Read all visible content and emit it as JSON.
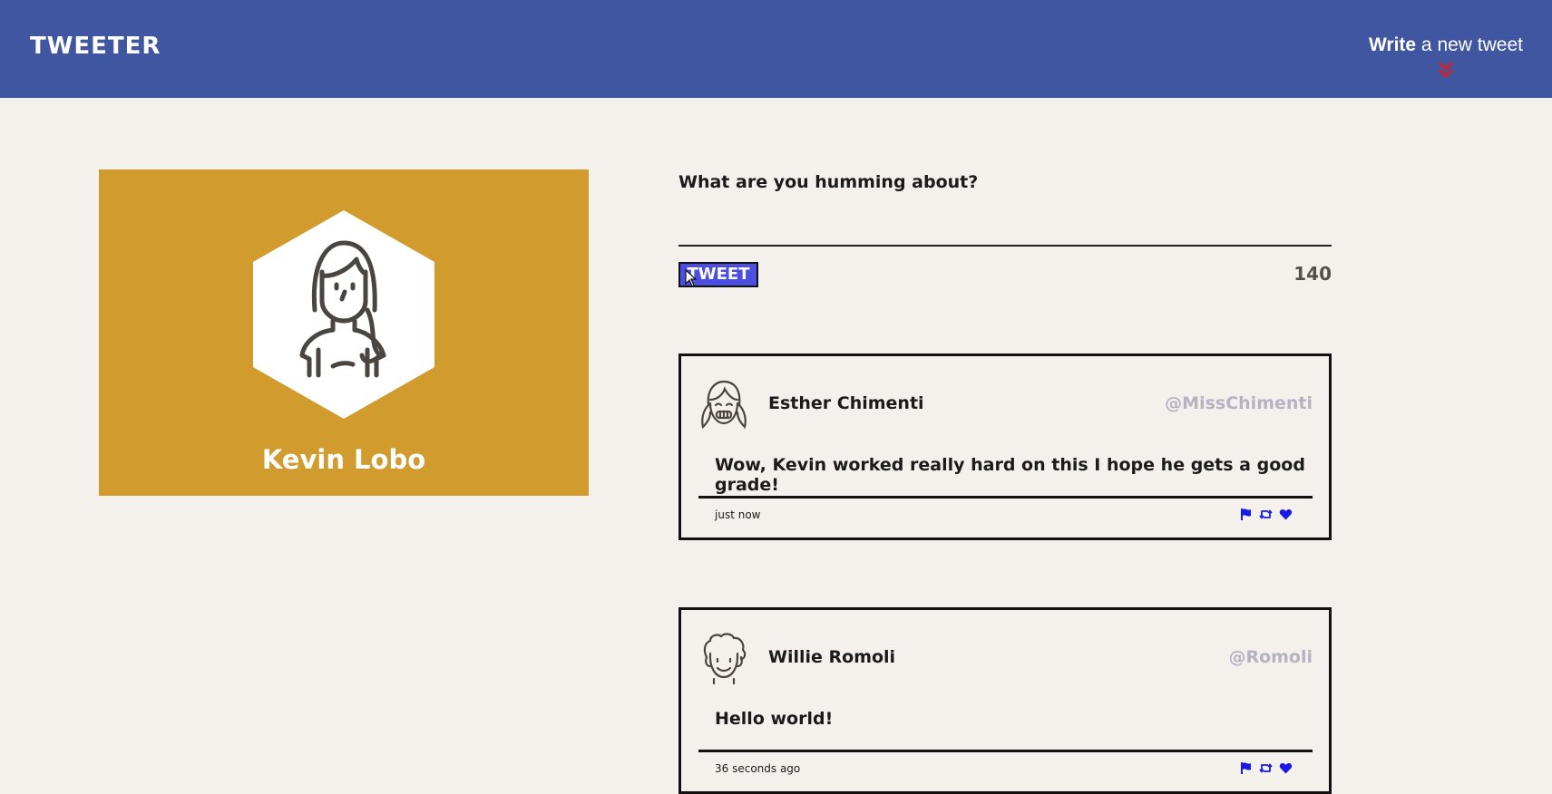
{
  "nav": {
    "brand": "TWEETER",
    "compose_bold": "Write",
    "compose_rest": " a new tweet",
    "chevron_icon": "double-chevron-down-icon",
    "chevron_color": "#d0202a",
    "background": "#4056a1"
  },
  "profile": {
    "name": "Kevin Lobo",
    "avatar_icon": "woman-avatar-icon",
    "background": "#d19b2e"
  },
  "compose": {
    "label": "What are you humming about?",
    "input_value": "",
    "button_label": "TWEET",
    "counter": "140",
    "button_color": "#4b4fe0"
  },
  "tweets": [
    {
      "avatar_icon": "girl-avatar-icon",
      "name": "Esther Chimenti",
      "handle": "@MissChimenti",
      "text": "Wow, Kevin worked really hard on this I hope he gets a good grade!",
      "time": "just now",
      "actions": [
        "flag-icon",
        "retweet-icon",
        "heart-icon"
      ]
    },
    {
      "avatar_icon": "man-avatar-icon",
      "name": "Willie Romoli",
      "handle": "@Romoli",
      "text": "Hello world!",
      "time": "36 seconds ago",
      "actions": [
        "flag-icon",
        "retweet-icon",
        "heart-icon"
      ]
    }
  ],
  "colors": {
    "page_bg": "#f4f1ec",
    "handle": "#b5b2c2",
    "action_icon": "#1a1ae6"
  }
}
